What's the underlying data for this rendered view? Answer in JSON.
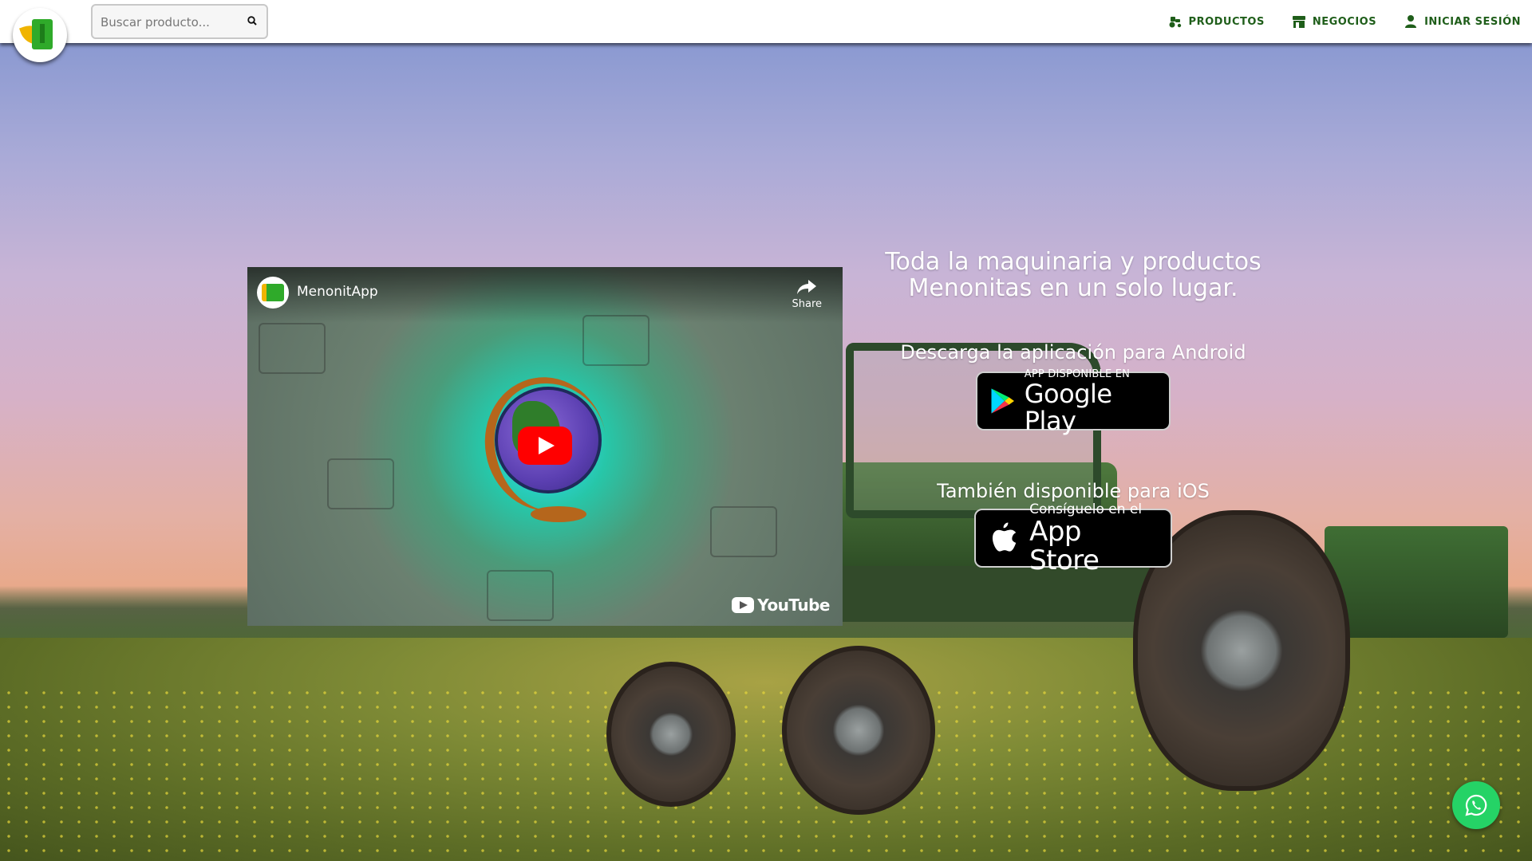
{
  "navbar": {
    "search_placeholder": "Buscar producto...",
    "links": [
      {
        "label": "PRODUCTOS",
        "icon": "tractor-icon"
      },
      {
        "label": "NEGOCIOS",
        "icon": "store-icon"
      },
      {
        "label": "INICIAR SESIÓN",
        "icon": "user-icon"
      }
    ]
  },
  "video": {
    "channel_name": "MenonitApp",
    "share_label": "Share",
    "platform_label": "YouTube"
  },
  "panel": {
    "tagline": "Toda la maquinaria y productos Menonitas en un solo lugar.",
    "android_label": "Descarga la aplicación para Android",
    "google_play_small": "APP DISPONIBLE EN",
    "google_play_big": "Google Play",
    "ios_label": "También disponible para iOS",
    "app_store_small": "Consíguelo en el",
    "app_store_big": "App Store"
  },
  "colors": {
    "nav_text": "#1f5e1a",
    "brand_green": "#2faa2a",
    "brand_yellow": "#f0b400",
    "whatsapp": "#25d366"
  }
}
